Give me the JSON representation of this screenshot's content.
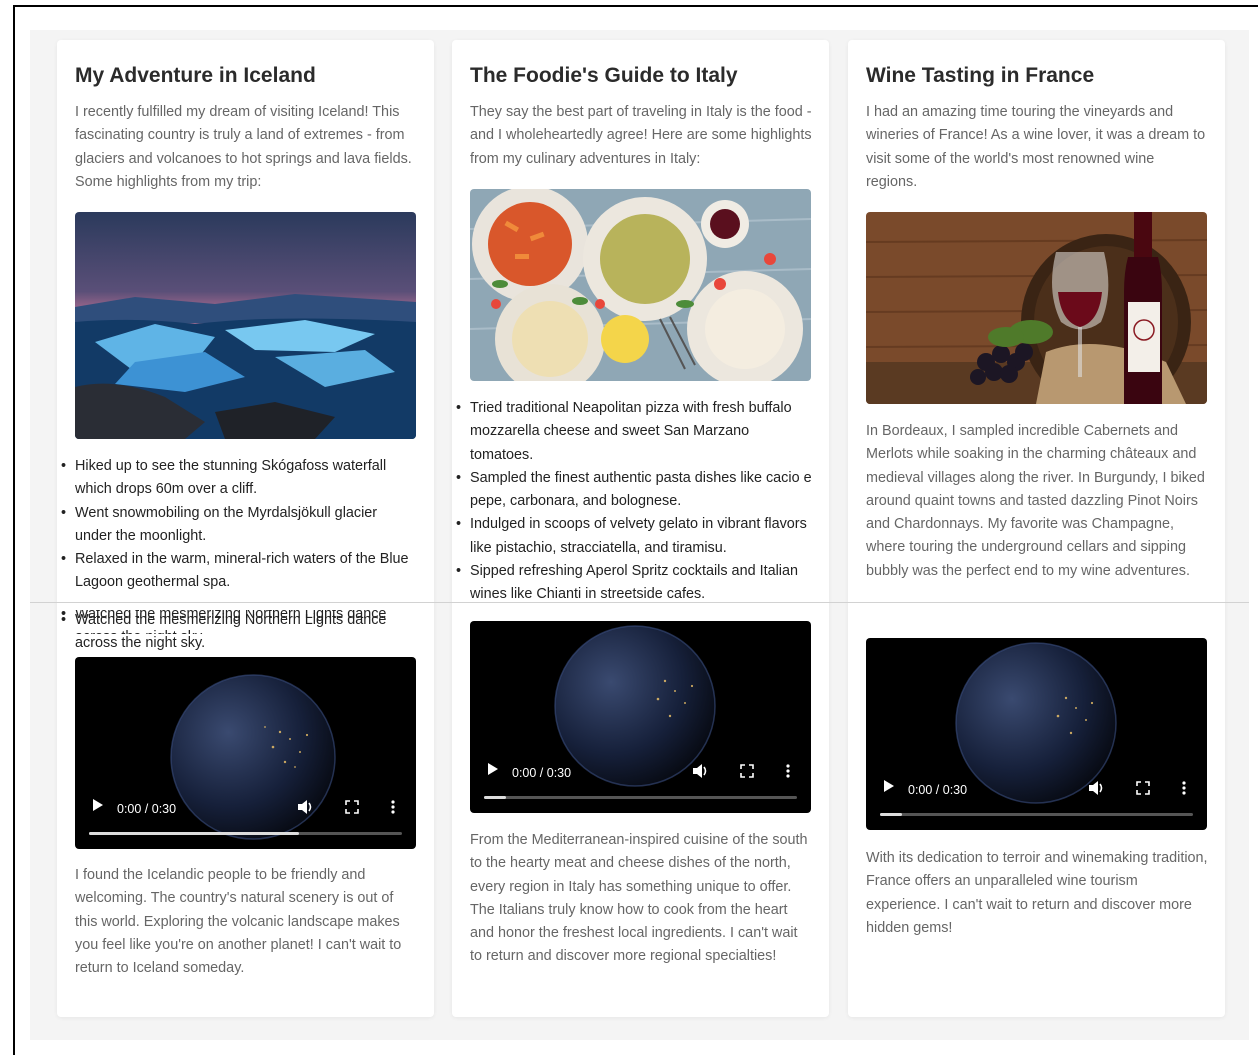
{
  "posts": [
    {
      "title": "My Adventure in Iceland",
      "intro": "I recently fulfilled my dream of visiting Iceland! This fascinating country is truly a land of extremes - from glaciers and volcanoes to hot springs and lava fields. Some highlights from my trip:",
      "highlights": [
        "Hiked up to see the stunning Skógafoss waterfall which drops 60m over a cliff.",
        "Went snowmobiling on the Myrdalsjökull glacier under the moonlight.",
        "Relaxed in the warm, mineral-rich waters of the Blue Lagoon geothermal spa.",
        "Watched the mesmerizing Northern Lights dance across the night sky."
      ],
      "video_time": "0:00 / 0:30",
      "video_progress": 0.67,
      "outro": "I found the Icelandic people to be friendly and welcoming. The country's natural scenery is out of this world. Exploring the volcanic landscape makes you feel like you're on another planet! I can't wait to return to Iceland someday."
    },
    {
      "title": "The Foodie's Guide to Italy",
      "intro": "They say the best part of traveling in Italy is the food - and I wholeheartedly agree! Here are some highlights from my culinary adventures in Italy:",
      "highlights": [
        "Tried traditional Neapolitan pizza with fresh buffalo mozzarella cheese and sweet San Marzano tomatoes.",
        "Sampled the finest authentic pasta dishes like cacio e pepe, carbonara, and bolognese.",
        "Indulged in scoops of velvety gelato in vibrant flavors like pistachio, stracciatella, and tiramisu.",
        "Sipped refreshing Aperol Spritz cocktails and Italian wines like Chianti in streetside cafes."
      ],
      "video_time": "0:00 / 0:30",
      "video_progress": 0.07,
      "outro": "From the Mediterranean-inspired cuisine of the south to the hearty meat and cheese dishes of the north, every region in Italy has something unique to offer. The Italians truly know how to cook from the heart and honor the freshest local ingredients. I can't wait to return and discover more regional specialties!"
    },
    {
      "title": "Wine Tasting in France",
      "intro": "I had an amazing time touring the vineyards and wineries of France! As a wine lover, it was a dream to visit some of the world's most renowned wine regions.",
      "body": "In Bordeaux, I sampled incredible Cabernets and Merlots while soaking in the charming châteaux and medieval villages along the river. In Burgundy, I biked around quaint towns and tasted dazzling Pinot Noirs and Chardonnays. My favorite was Champagne, where touring the underground cellars and sipping bubbly was the perfect end to my wine adventures.",
      "video_time": "0:00 / 0:30",
      "video_progress": 0.07,
      "outro": "With its dedication to terroir and winemaking tradition, France offers an unparalleled wine tourism experience. I can't wait to return and discover more hidden gems!"
    }
  ],
  "colors": {
    "page_bg": "#f4f4f4",
    "card_bg": "#ffffff",
    "title": "#2b2b2b",
    "paragraph": "#666666",
    "list_text": "#222222"
  },
  "icons": [
    "play-icon",
    "volume-icon",
    "fullscreen-icon",
    "more-options-icon"
  ]
}
